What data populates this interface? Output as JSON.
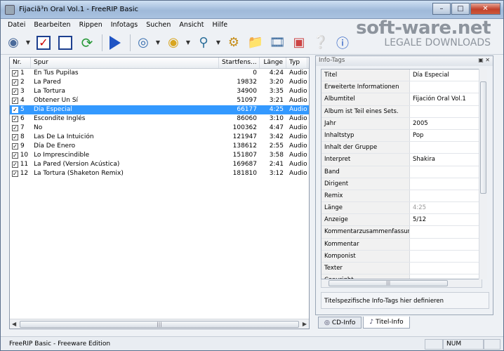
{
  "window": {
    "title": "Fijaciã³n Oral Vol.1 - FreeRIP Basic",
    "min": "–",
    "max": "□",
    "close": "✕"
  },
  "menu": [
    "Datei",
    "Bearbeiten",
    "Rippen",
    "Infotags",
    "Suchen",
    "Ansicht",
    "Hilfe"
  ],
  "watermark": {
    "line1": "soft-ware.net",
    "line2": "LEGALE DOWNLOADS"
  },
  "toolbar": {
    "icons": [
      "cd-drive-icon",
      "check-all-icon",
      "uncheck-all-icon",
      "refresh-icon",
      "play-icon",
      "rip-cd-icon",
      "encode-icon",
      "search-icon",
      "settings-icon",
      "folder-icon",
      "film-icon",
      "apps-icon",
      "help-icon",
      "info-icon"
    ]
  },
  "tracklist": {
    "columns": [
      "Nr.",
      "Spur",
      "Startfens...",
      "Länge",
      "Typ"
    ],
    "rows": [
      {
        "nr": "1",
        "title": "En Tus Pupilas",
        "start": "0",
        "len": "4:24",
        "type": "Audio"
      },
      {
        "nr": "2",
        "title": "La Pared",
        "start": "19832",
        "len": "3:20",
        "type": "Audio"
      },
      {
        "nr": "3",
        "title": "La Tortura",
        "start": "34900",
        "len": "3:35",
        "type": "Audio"
      },
      {
        "nr": "4",
        "title": "Obtener Un Sí",
        "start": "51097",
        "len": "3:21",
        "type": "Audio"
      },
      {
        "nr": "5",
        "title": "Día Especial",
        "start": "66177",
        "len": "4:25",
        "type": "Audio"
      },
      {
        "nr": "6",
        "title": "Escondite Inglés",
        "start": "86060",
        "len": "3:10",
        "type": "Audio"
      },
      {
        "nr": "7",
        "title": "No",
        "start": "100362",
        "len": "4:47",
        "type": "Audio"
      },
      {
        "nr": "8",
        "title": "Las De La Intuición",
        "start": "121947",
        "len": "3:42",
        "type": "Audio"
      },
      {
        "nr": "9",
        "title": "Día De Enero",
        "start": "138612",
        "len": "2:55",
        "type": "Audio"
      },
      {
        "nr": "10",
        "title": "Lo Imprescindible",
        "start": "151807",
        "len": "3:58",
        "type": "Audio"
      },
      {
        "nr": "11",
        "title": "La Pared (Version Acústica)",
        "start": "169687",
        "len": "2:41",
        "type": "Audio"
      },
      {
        "nr": "12",
        "title": "La Tortura (Shaketon Remix)",
        "start": "181810",
        "len": "3:12",
        "type": "Audio"
      }
    ]
  },
  "infotags": {
    "title": "Info-Tags",
    "rows": [
      {
        "key": "Titel",
        "value": "Día Especial"
      },
      {
        "key": "Erweiterte Informationen",
        "value": ""
      },
      {
        "key": "Albumtitel",
        "value": "Fijación Oral Vol.1"
      },
      {
        "key": "Album ist Teil eines Sets.",
        "value": ""
      },
      {
        "key": "Jahr",
        "value": "2005"
      },
      {
        "key": "Inhaltstyp",
        "value": "Pop"
      },
      {
        "key": "Inhalt der Gruppe",
        "value": ""
      },
      {
        "key": "Interpret",
        "value": "Shakira"
      },
      {
        "key": "Band",
        "value": ""
      },
      {
        "key": "Dirigent",
        "value": ""
      },
      {
        "key": "Remix",
        "value": ""
      },
      {
        "key": "Länge",
        "value": "4:25"
      },
      {
        "key": "Anzeige",
        "value": "5/12"
      },
      {
        "key": "Kommentarzusammenfassung",
        "value": ""
      },
      {
        "key": "Kommentar",
        "value": ""
      },
      {
        "key": "Komponist",
        "value": ""
      },
      {
        "key": "Texter",
        "value": ""
      },
      {
        "key": "Copyright",
        "value": ""
      }
    ],
    "description": "Titelspezifische Info-Tags hier definieren"
  },
  "tabs": [
    "CD-Info",
    "Titel-Info"
  ],
  "status": {
    "text": "FreeRIP Basic - Freeware Edition",
    "num": "NUM"
  }
}
